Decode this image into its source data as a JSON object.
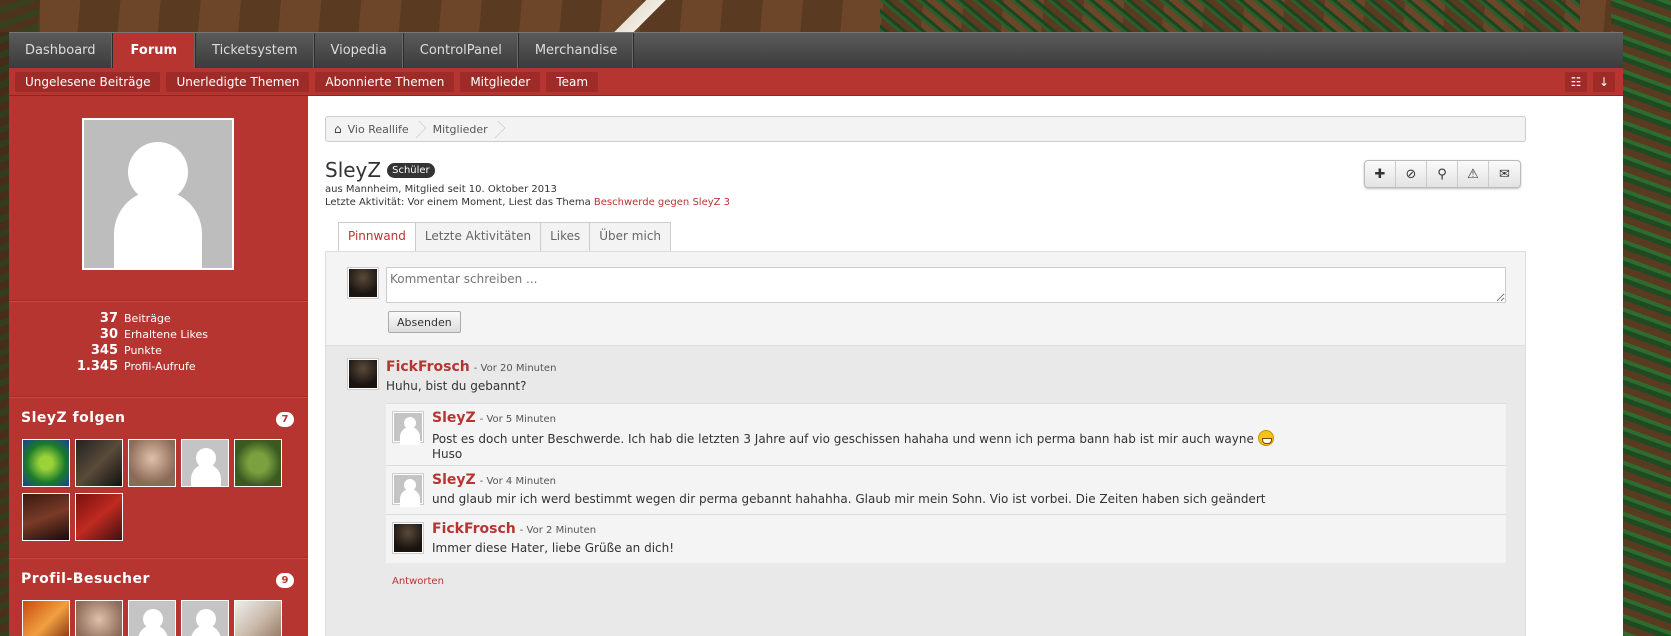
{
  "nav": {
    "main_tabs": [
      "Dashboard",
      "Forum",
      "Ticketsystem",
      "Viopedia",
      "ControlPanel",
      "Merchandise"
    ],
    "sub_items": [
      "Ungelesene Beiträge",
      "Unerledigte Themen",
      "Abonnierte Themen",
      "Mitglieder",
      "Team"
    ]
  },
  "breadcrumb": [
    "Vio Reallife",
    "Mitglieder"
  ],
  "profile": {
    "name": "SleyZ",
    "rank": "Schüler",
    "meta": "aus Mannheim, Mitglied seit 10. Oktober 2013",
    "activity_prefix": "Letzte Aktivität: Vor einem Moment, Liest das Thema",
    "activity_link": "Beschwerde gegen SleyZ 3"
  },
  "stats": [
    {
      "num": "37",
      "label": "Beiträge"
    },
    {
      "num": "30",
      "label": "Erhaltene Likes"
    },
    {
      "num": "345",
      "label": "Punkte"
    },
    {
      "num": "1.345",
      "label": "Profil-Aufrufe"
    }
  ],
  "following": {
    "title": "SleyZ folgen",
    "count": "7"
  },
  "visitors": {
    "title": "Profil-Besucher",
    "count": "9"
  },
  "tabs": [
    "Pinnwand",
    "Letzte Aktivitäten",
    "Likes",
    "Über mich"
  ],
  "comment_form": {
    "placeholder": "Kommentar schreiben ...",
    "submit": "Absenden"
  },
  "post": {
    "author": "FickFrosch",
    "time": "- Vor 20 Minuten",
    "text": "Huhu, bist du gebannt?",
    "replies": [
      {
        "author": "SleyZ",
        "time": "- Vor 5 Minuten",
        "line1": "Post es doch unter Beschwerde. Ich hab die letzten 3 Jahre auf vio geschissen hahaha und wenn ich perma bann hab ist mir auch wayne",
        "line2": "Huso"
      },
      {
        "author": "SleyZ",
        "time": "- Vor 4 Minuten",
        "line1": "und glaub mir ich werd bestimmt wegen dir perma gebannt hahahha. Glaub mir mein Sohn. Vio ist vorbei. Die Zeiten haben sich geändert"
      },
      {
        "author": "FickFrosch",
        "time": "- Vor 2 Minuten",
        "line1": "Immer diese Hater, liebe Grüße an dich!"
      }
    ],
    "reply_link": "Antworten"
  },
  "colors": {
    "accent": "#b73531",
    "nav": "#4a4a4a"
  },
  "icons": [
    "home-icon",
    "sitemap-icon",
    "arrow-down-icon",
    "plus-icon",
    "block-icon",
    "search-icon",
    "warning-icon",
    "chat-icon",
    "grin-emoji-icon"
  ]
}
